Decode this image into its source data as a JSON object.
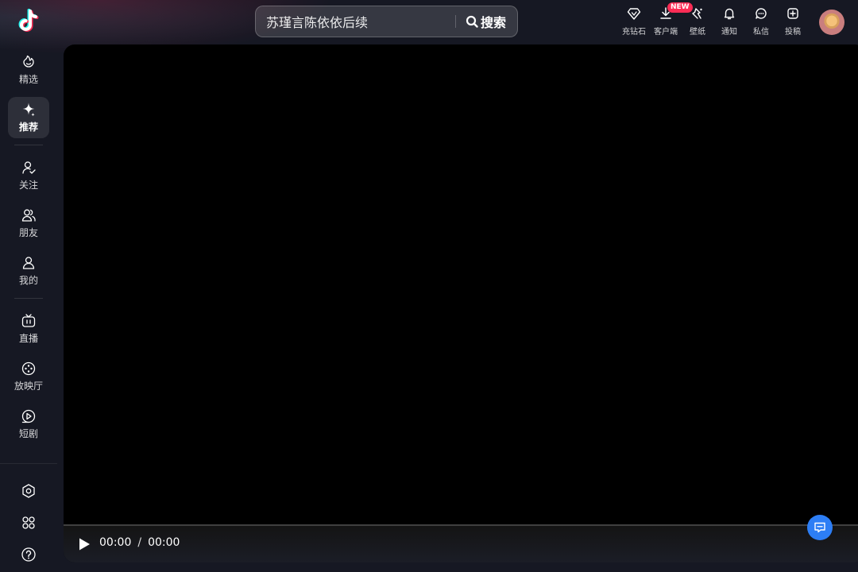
{
  "header": {
    "search_value": "苏瑾言陈依依后续",
    "search_button": "搜索",
    "actions": [
      {
        "icon": "diamond-icon",
        "label": "充钻石"
      },
      {
        "icon": "download-icon",
        "label": "客户端",
        "badge": "NEW"
      },
      {
        "icon": "wallpaper-icon",
        "label": "壁纸"
      },
      {
        "icon": "bell-icon",
        "label": "通知"
      },
      {
        "icon": "message-icon",
        "label": "私信"
      },
      {
        "icon": "upload-icon",
        "label": "投稿"
      }
    ]
  },
  "sidebar": {
    "items": [
      {
        "icon": "featured-icon",
        "label": "精选"
      },
      {
        "icon": "recommend-icon",
        "label": "推荐",
        "active": true
      },
      {
        "icon": "follow-icon",
        "label": "关注"
      },
      {
        "icon": "friends-icon",
        "label": "朋友"
      },
      {
        "icon": "profile-icon",
        "label": "我的"
      },
      {
        "icon": "live-icon",
        "label": "直播"
      },
      {
        "icon": "cinema-icon",
        "label": "放映厅"
      },
      {
        "icon": "short-drama-icon",
        "label": "短剧"
      }
    ],
    "bottom": [
      "settings-icon",
      "more-apps-icon",
      "help-icon"
    ]
  },
  "player": {
    "current_time": "00:00",
    "separator": "/",
    "duration": "00:00",
    "progress": 0
  },
  "colors": {
    "background": "#161823",
    "badge": "#fe2c55",
    "fab": "#2d7ef5"
  }
}
